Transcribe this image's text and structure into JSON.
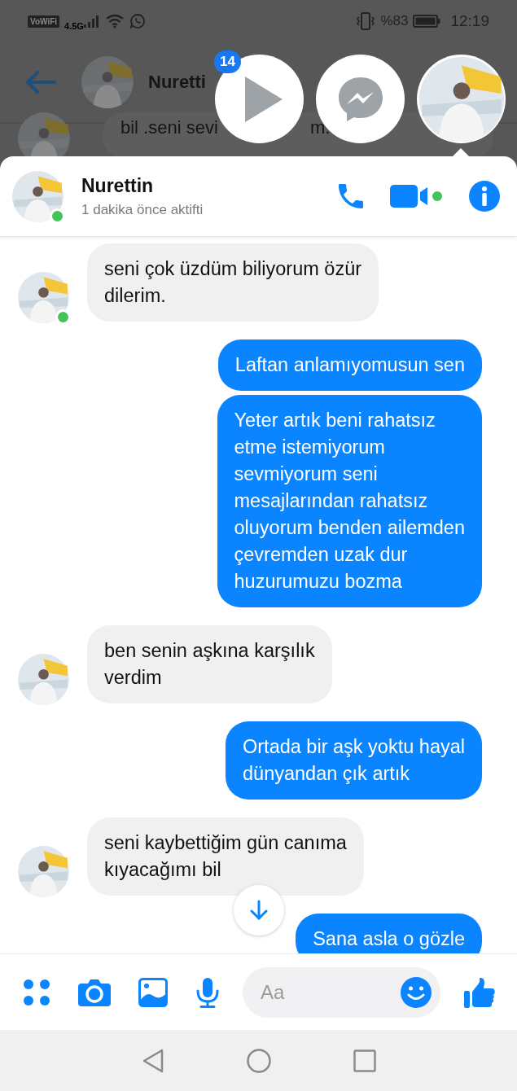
{
  "status_bar": {
    "wifi_call": "VoWiFi",
    "network": "4.5G",
    "battery": "%83",
    "time": "12:19"
  },
  "background_chat": {
    "title": "Nuretti",
    "message_fragments": [
      "bil .seni sevi",
      "m."
    ]
  },
  "chat_heads": {
    "badge": "14"
  },
  "conversation": {
    "name": "Nurettin",
    "status": "1 dakika önce aktifti",
    "online": true
  },
  "messages": [
    {
      "kind": "received",
      "text": "seni çok üzdüm biliyorum özür\ndilerim.",
      "online": true
    },
    {
      "kind": "sent",
      "text": "Laftan anlamıyomusun sen"
    },
    {
      "kind": "sent",
      "text": "Yeter artık beni rahatsız\netme istemiyorum\nsevmiyorum seni\nmesajlarından rahatsız\noluyorum benden ailemden\nçevremden uzak dur\nhuzurumuzu bozma"
    },
    {
      "kind": "received",
      "text": "ben senin aşkına karşılık\nverdim",
      "online": false
    },
    {
      "kind": "sent",
      "text": "Ortada bir aşk yoktu hayal\ndünyandan çık artık"
    },
    {
      "kind": "received",
      "text": "seni kaybettiğim gün canıma\nkıyacağımı bil",
      "online": false
    },
    {
      "kind": "sent",
      "text": "Sana asla o gözle"
    }
  ],
  "composer": {
    "placeholder": "Aa"
  }
}
